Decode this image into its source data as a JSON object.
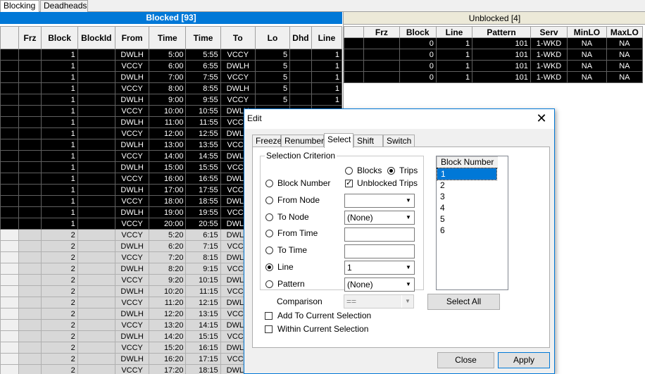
{
  "top_tabs": [
    "Blocking",
    "Deadheads"
  ],
  "blocked": {
    "title": "Blocked  [93]",
    "columns": [
      "Frz",
      "Block",
      "BlockId",
      "From",
      "Time",
      "Time",
      "To",
      "Lo",
      "Dhd",
      "Line"
    ],
    "rows": [
      {
        "style": "blk",
        "block": "1",
        "from": "DWLH",
        "t1": "5:00",
        "t2": "5:55",
        "to": "VCCY",
        "lo": "5",
        "line": "1"
      },
      {
        "style": "blk",
        "block": "1",
        "from": "VCCY",
        "t1": "6:00",
        "t2": "6:55",
        "to": "DWLH",
        "lo": "5",
        "line": "1"
      },
      {
        "style": "blk",
        "block": "1",
        "from": "DWLH",
        "t1": "7:00",
        "t2": "7:55",
        "to": "VCCY",
        "lo": "5",
        "line": "1"
      },
      {
        "style": "blk",
        "block": "1",
        "from": "VCCY",
        "t1": "8:00",
        "t2": "8:55",
        "to": "DWLH",
        "lo": "5",
        "line": "1"
      },
      {
        "style": "blk",
        "block": "1",
        "from": "DWLH",
        "t1": "9:00",
        "t2": "9:55",
        "to": "VCCY",
        "lo": "5",
        "line": "1"
      },
      {
        "style": "blk",
        "block": "1",
        "from": "VCCY",
        "t1": "10:00",
        "t2": "10:55",
        "to": "DWLH",
        "lo": "",
        "line": ""
      },
      {
        "style": "blk",
        "block": "1",
        "from": "DWLH",
        "t1": "11:00",
        "t2": "11:55",
        "to": "VCCY",
        "lo": "",
        "line": ""
      },
      {
        "style": "blk",
        "block": "1",
        "from": "VCCY",
        "t1": "12:00",
        "t2": "12:55",
        "to": "DWLH",
        "lo": "",
        "line": ""
      },
      {
        "style": "blk",
        "block": "1",
        "from": "DWLH",
        "t1": "13:00",
        "t2": "13:55",
        "to": "VCCY",
        "lo": "",
        "line": ""
      },
      {
        "style": "blk",
        "block": "1",
        "from": "VCCY",
        "t1": "14:00",
        "t2": "14:55",
        "to": "DWLH",
        "lo": "",
        "line": ""
      },
      {
        "style": "blk",
        "block": "1",
        "from": "DWLH",
        "t1": "15:00",
        "t2": "15:55",
        "to": "VCCY",
        "lo": "",
        "line": ""
      },
      {
        "style": "blk",
        "block": "1",
        "from": "VCCY",
        "t1": "16:00",
        "t2": "16:55",
        "to": "DWLH",
        "lo": "",
        "line": ""
      },
      {
        "style": "blk",
        "block": "1",
        "from": "DWLH",
        "t1": "17:00",
        "t2": "17:55",
        "to": "VCCY",
        "lo": "",
        "line": ""
      },
      {
        "style": "blk",
        "block": "1",
        "from": "VCCY",
        "t1": "18:00",
        "t2": "18:55",
        "to": "DWLH",
        "lo": "",
        "line": ""
      },
      {
        "style": "blk",
        "block": "1",
        "from": "DWLH",
        "t1": "19:00",
        "t2": "19:55",
        "to": "VCCY",
        "lo": "",
        "line": ""
      },
      {
        "style": "blk",
        "block": "1",
        "from": "VCCY",
        "t1": "20:00",
        "t2": "20:55",
        "to": "DWLH",
        "lo": "",
        "line": ""
      },
      {
        "style": "gry",
        "block": "2",
        "from": "VCCY",
        "t1": "5:20",
        "t2": "6:15",
        "to": "DWLH",
        "lo": "",
        "line": ""
      },
      {
        "style": "gry",
        "block": "2",
        "from": "DWLH",
        "t1": "6:20",
        "t2": "7:15",
        "to": "VCCY",
        "lo": "",
        "line": ""
      },
      {
        "style": "gry",
        "block": "2",
        "from": "VCCY",
        "t1": "7:20",
        "t2": "8:15",
        "to": "DWLH",
        "lo": "",
        "line": ""
      },
      {
        "style": "gry",
        "block": "2",
        "from": "DWLH",
        "t1": "8:20",
        "t2": "9:15",
        "to": "VCCY",
        "lo": "",
        "line": ""
      },
      {
        "style": "gry",
        "block": "2",
        "from": "VCCY",
        "t1": "9:20",
        "t2": "10:15",
        "to": "DWLH",
        "lo": "",
        "line": ""
      },
      {
        "style": "gry",
        "block": "2",
        "from": "DWLH",
        "t1": "10:20",
        "t2": "11:15",
        "to": "VCCY",
        "lo": "",
        "line": ""
      },
      {
        "style": "gry",
        "block": "2",
        "from": "VCCY",
        "t1": "11:20",
        "t2": "12:15",
        "to": "DWLH",
        "lo": "",
        "line": ""
      },
      {
        "style": "gry",
        "block": "2",
        "from": "DWLH",
        "t1": "12:20",
        "t2": "13:15",
        "to": "VCCY",
        "lo": "",
        "line": ""
      },
      {
        "style": "gry",
        "block": "2",
        "from": "VCCY",
        "t1": "13:20",
        "t2": "14:15",
        "to": "DWLH",
        "lo": "",
        "line": ""
      },
      {
        "style": "gry",
        "block": "2",
        "from": "DWLH",
        "t1": "14:20",
        "t2": "15:15",
        "to": "VCCY",
        "lo": "",
        "line": ""
      },
      {
        "style": "gry",
        "block": "2",
        "from": "VCCY",
        "t1": "15:20",
        "t2": "16:15",
        "to": "DWLH",
        "lo": "",
        "line": ""
      },
      {
        "style": "gry",
        "block": "2",
        "from": "DWLH",
        "t1": "16:20",
        "t2": "17:15",
        "to": "VCCY",
        "lo": "",
        "line": ""
      },
      {
        "style": "gry",
        "block": "2",
        "from": "VCCY",
        "t1": "17:20",
        "t2": "18:15",
        "to": "DWLH",
        "lo": "",
        "line": ""
      }
    ]
  },
  "unblocked": {
    "title": "Unblocked  [4]",
    "columns": [
      "Frz",
      "Block",
      "Line",
      "Pattern",
      "Serv",
      "MinLO",
      "MaxLO"
    ],
    "rows": [
      {
        "frz": "",
        "block": "0",
        "line": "1",
        "pattern": "101",
        "serv": "1-WKD",
        "minlo": "NA",
        "maxlo": "NA"
      },
      {
        "frz": "",
        "block": "0",
        "line": "1",
        "pattern": "101",
        "serv": "1-WKD",
        "minlo": "NA",
        "maxlo": "NA"
      },
      {
        "frz": "",
        "block": "0",
        "line": "1",
        "pattern": "101",
        "serv": "1-WKD",
        "minlo": "NA",
        "maxlo": "NA"
      },
      {
        "frz": "",
        "block": "0",
        "line": "1",
        "pattern": "101",
        "serv": "1-WKD",
        "minlo": "NA",
        "maxlo": "NA"
      }
    ]
  },
  "dialog": {
    "title": "Edit",
    "close_glyph": "✕",
    "tabs": [
      "Freeze",
      "Renumber",
      "Select",
      "Shift",
      "Switch"
    ],
    "active_tab": "Select",
    "group_title": "Selection Criterion",
    "mode_blocks": "Blocks",
    "mode_trips": "Trips",
    "unblocked_trips": "Unblocked Trips",
    "criteria": [
      {
        "label": "Block Number",
        "selected": false,
        "control": "none",
        "value": ""
      },
      {
        "label": "From Node",
        "selected": false,
        "control": "combo",
        "value": ""
      },
      {
        "label": "To Node",
        "selected": false,
        "control": "combo",
        "value": "(None)"
      },
      {
        "label": "From Time",
        "selected": false,
        "control": "text",
        "value": ""
      },
      {
        "label": "To Time",
        "selected": false,
        "control": "text",
        "value": ""
      },
      {
        "label": "Line",
        "selected": true,
        "control": "combo",
        "value": "1"
      },
      {
        "label": "Pattern",
        "selected": false,
        "control": "combo",
        "value": "(None)"
      }
    ],
    "comparison_label": "Comparison",
    "comparison_value": "==",
    "add_to_selection": "Add To Current Selection",
    "within_selection": "Within Current Selection",
    "list_header": "Block Number",
    "list_items": [
      "1",
      "2",
      "3",
      "4",
      "5",
      "6"
    ],
    "select_all": "Select All",
    "close_btn": "Close",
    "apply_btn": "Apply"
  }
}
